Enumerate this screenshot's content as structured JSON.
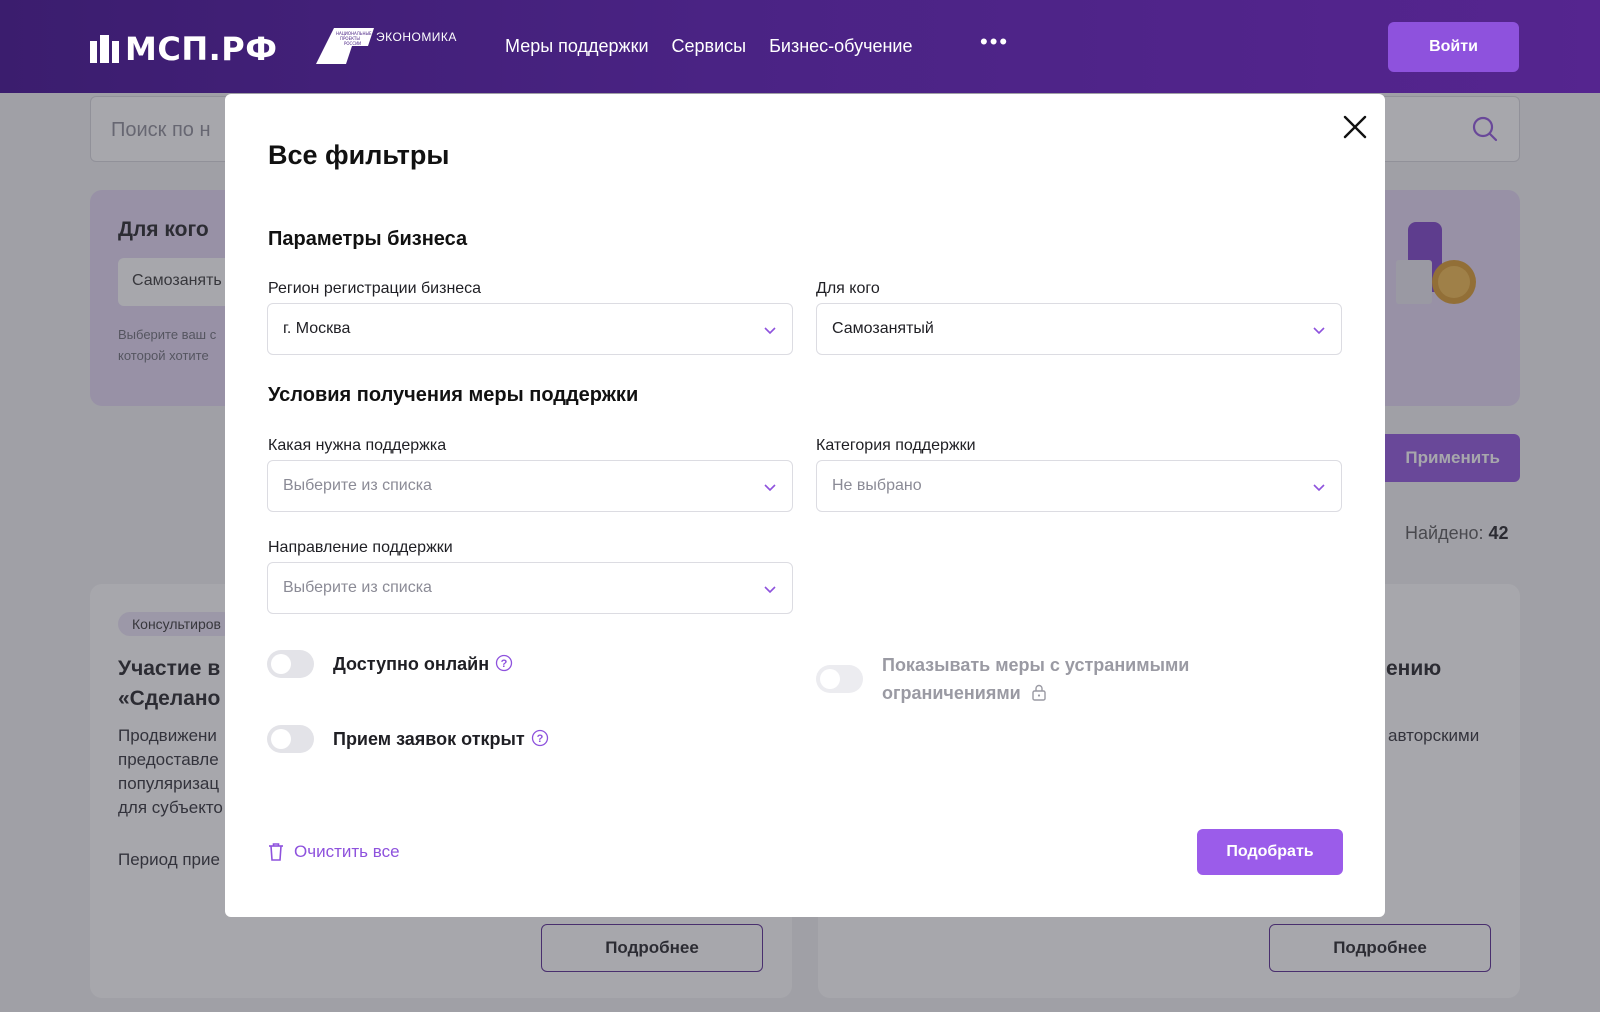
{
  "header": {
    "logo_text": "МСП.РФ",
    "np_text": "НАЦИОНАЛЬНЫЕ ПРОЕКТЫ РОССИИ",
    "np_econ": "ЭКОНОМИКА",
    "nav": [
      "Меры поддержки",
      "Сервисы",
      "Бизнес-обучение"
    ],
    "more": "•••",
    "login": "Войти"
  },
  "background": {
    "search_placeholder": "Поиск по н",
    "filter_title": "Для кого",
    "filter_value": "Самозанять",
    "filter_hint_1": "Выберите ваш с",
    "filter_hint_2": "которой хотите",
    "apply": "Применить",
    "found_label": "Найдено:",
    "found_count": "42",
    "card1": {
      "tag": "Консультиров",
      "title_1": "Участие в",
      "title_2": "«Сделано",
      "desc": [
        "Продвижени",
        "предоставле",
        "популяризац",
        "для субъекто"
      ],
      "period": "Период прие",
      "more": "Подробнее"
    },
    "card2": {
      "title_1": "ению",
      "desc_1": "авторскими",
      "more": "Подробнее"
    }
  },
  "modal": {
    "title": "Все фильтры",
    "section_business": "Параметры бизнеса",
    "region_label": "Регион регистрации бизнеса",
    "region_value": "г. Москва",
    "for_whom_label": "Для кого",
    "for_whom_value": "Самозанятый",
    "section_conditions": "Условия получения меры поддержки",
    "support_type_label": "Какая нужна поддержка",
    "support_type_placeholder": "Выберите из списка",
    "category_label": "Категория поддержки",
    "category_placeholder": "Не выбрано",
    "direction_label": "Направление поддержки",
    "direction_placeholder": "Выберите из списка",
    "toggle_online": "Доступно онлайн",
    "toggle_open": "Прием заявок открыт",
    "toggle_restrictions_1": "Показывать меры с устранимыми",
    "toggle_restrictions_2": "ограничениями",
    "clear_all": "Очистить все",
    "submit": "Подобрать"
  },
  "colors": {
    "accent": "#9b5cea",
    "header": "#4a2384",
    "toggle_off": "#e3e3e8"
  }
}
